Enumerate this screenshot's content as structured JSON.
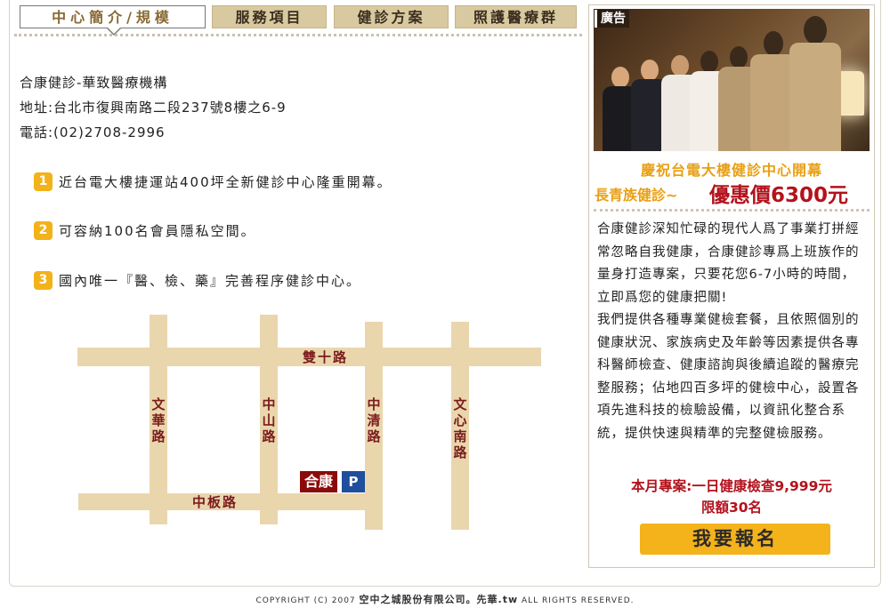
{
  "tabs": [
    {
      "label": "中心簡介/規模"
    },
    {
      "label": "服務項目"
    },
    {
      "label": "健診方案"
    },
    {
      "label": "照護醫療群"
    }
  ],
  "info": {
    "name": "合康健診-華致醫療機構",
    "address": "地址:台北市復興南路二段237號8樓之6-9",
    "phone": "電話:(02)2708-2996"
  },
  "features": [
    {
      "num": "1",
      "text": "近台電大樓捷運站400坪全新健診中心隆重開幕。"
    },
    {
      "num": "2",
      "text": "可容納100名會員隱私空間。"
    },
    {
      "num": "3",
      "text": "國內唯一『醫、檢、藥』完善程序健診中心。"
    }
  ],
  "map": {
    "roads": {
      "shuangshi": "雙十路",
      "wenhua": "文華路",
      "zhongshan": "中山路",
      "zhongqing": "中清路",
      "wenxin": "文心南路",
      "zhongban": "中板路"
    },
    "hq_label": "合康",
    "parking_label": "P",
    "road_color": "#ead6ad",
    "label_color": "#7a1c1c"
  },
  "ad": {
    "tag": "廣告",
    "headline": "慶祝台電大樓健診中心開幕",
    "subline": "長青族健診~",
    "price": "優惠價6300元"
  },
  "description": [
    "合康健診深知忙碌的現代人爲了事業打拼經常忽略自我健康，合康健診專爲上班族作的量身打造專案，只要花您6-7小時的時間，立即爲您的健康把關!",
    "我們提供各種專業健檢套餐，且依照個別的健康狀況、家族病史及年齡等因素提供各專科醫師檢查、健康諮詢與後續追蹤的醫療完整服務；佔地四百多坪的健檢中心，設置各項先進科技的檢驗設備，以資訊化整合系統，提供快速與精準的完整健檢服務。"
  ],
  "plan": {
    "line1": "本月專案:一日健康檢查9,999元",
    "line2": "限額30名"
  },
  "signup_label": "我要報名",
  "footer": {
    "left": "COPYRIGHT (C) 2007 ",
    "company": "空中之城股份有限公司。先華.tw",
    "right": " ALL RIGHTS RESERVED."
  },
  "colors": {
    "accent": "#f3b21a",
    "price_red": "#b3121c",
    "tab_bg": "#d9c9a0",
    "promo_gold": "#e8a015"
  }
}
